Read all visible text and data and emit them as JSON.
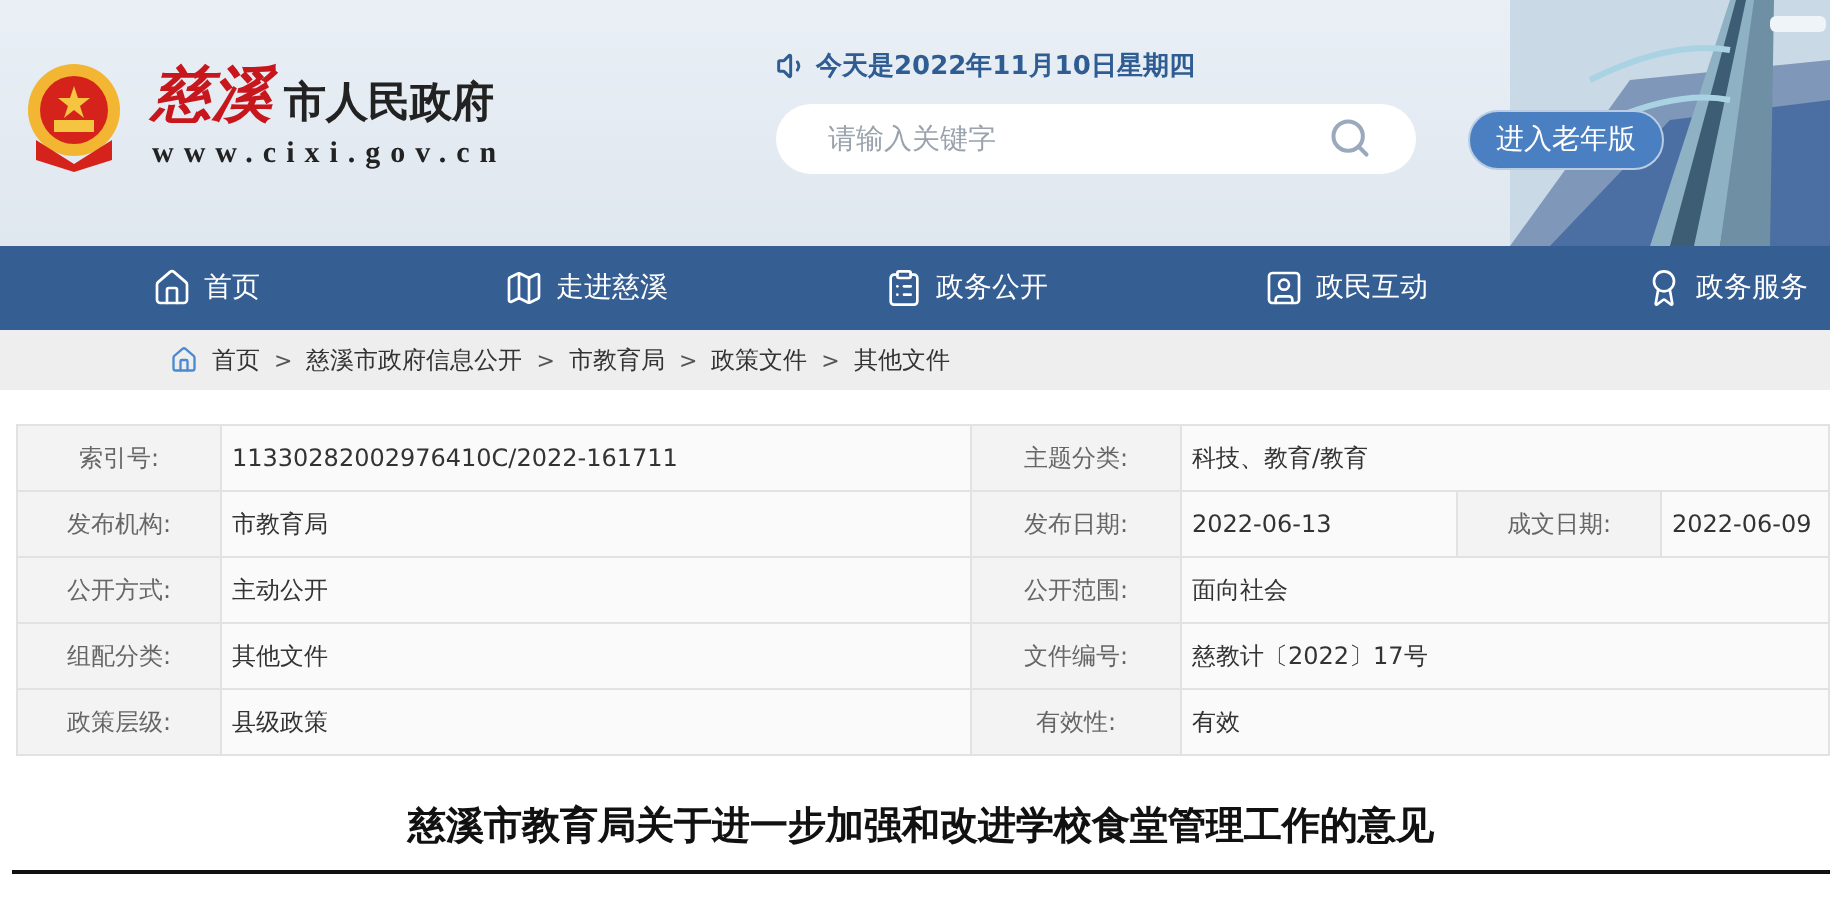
{
  "header": {
    "logo_calligraphy": "慈溪",
    "logo_name": "市人民政府",
    "logo_url": "www.cixi.gov.cn",
    "date": "今天是2022年11月10日星期四",
    "search": {
      "placeholder": "请输入关键字"
    },
    "elder_button": "进入老年版"
  },
  "nav": [
    {
      "label": "首页",
      "kind": "home"
    },
    {
      "label": "走进慈溪",
      "kind": "map"
    },
    {
      "label": "政务公开",
      "kind": "clipboard"
    },
    {
      "label": "政民互动",
      "kind": "card"
    },
    {
      "label": "政务服务",
      "kind": "award"
    }
  ],
  "breadcrumb": {
    "separator": ">",
    "items": [
      "首页",
      "慈溪市政府信息公开",
      "市教育局",
      "政策文件",
      "其他文件"
    ]
  },
  "info_table": [
    [
      {
        "label": "索引号:",
        "value": "11330282002976410C/2022-161711"
      },
      {
        "label": "主题分类:",
        "value": "科技、教育/教育"
      }
    ],
    [
      {
        "label": "发布机构:",
        "value": "市教育局"
      },
      {
        "label": "发布日期:",
        "value": "2022-06-13"
      },
      {
        "label": "成文日期:",
        "value": "2022-06-09"
      }
    ],
    [
      {
        "label": "公开方式:",
        "value": "主动公开"
      },
      {
        "label": "公开范围:",
        "value": "面向社会"
      }
    ],
    [
      {
        "label": "组配分类:",
        "value": "其他文件"
      },
      {
        "label": "文件编号:",
        "value": "慈教计〔2022〕17号"
      }
    ],
    [
      {
        "label": "政策层级:",
        "value": "县级政策"
      },
      {
        "label": "有效性:",
        "value": "有效"
      }
    ]
  ],
  "document_title": "慈溪市教育局关于进一步加强和改进学校食堂管理工作的意见"
}
